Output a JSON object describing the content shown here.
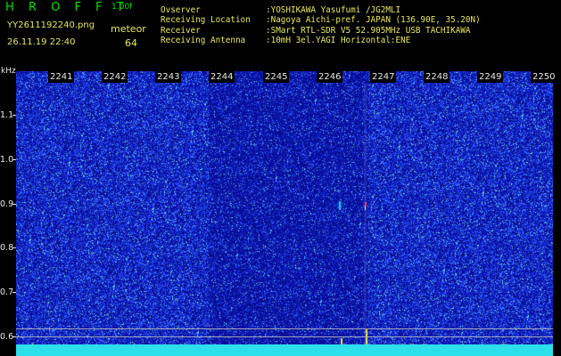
{
  "app": {
    "title": "H R O F F T",
    "version": "1.00f"
  },
  "file": {
    "name": "YY2611192240.png",
    "datetime": "26.11.19 22:40"
  },
  "detection": {
    "label": "meteor",
    "count": "64"
  },
  "station": [
    {
      "label": "Ovserver",
      "value": ":YOSHIKAWA Yasufumi /JG2MLI"
    },
    {
      "label": "Receiving Location",
      "value": ":Nagoya Aichi-pref. JAPAN (136.90E, 35.20N)"
    },
    {
      "label": "Receiver",
      "value": ":SMart RTL-SDR V5 52.905MHz USB TACHIKAWA"
    },
    {
      "label": "Receiving Antenna",
      "value": ":10mH 3el.YAGI Horizontal:ENE"
    }
  ],
  "chart_data": {
    "type": "heatmap",
    "ylabel": "kHz",
    "x_ticks": [
      "2241",
      "2242",
      "2243",
      "2244",
      "2245",
      "2246",
      "2247",
      "2248",
      "2249",
      "2250"
    ],
    "y_ticks": [
      "1.1",
      "1.0",
      "0.9",
      "0.8",
      "0.7",
      "0.6"
    ],
    "colors": {
      "background": "#0b11a6",
      "noise": "#1f3cff",
      "echo": "#ff4060",
      "trace": "#00e0ff"
    }
  }
}
